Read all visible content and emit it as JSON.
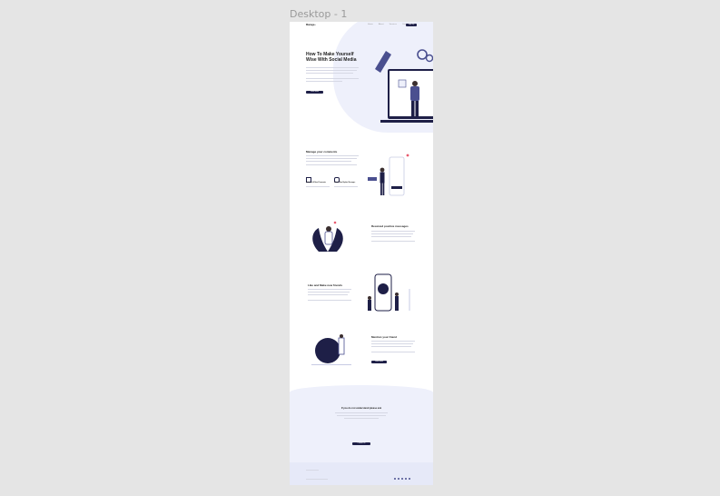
{
  "frame_title": "Desktop - 1",
  "nav": {
    "logo": "Manage+",
    "links": [
      "Home",
      "About",
      "Services",
      "Contact"
    ],
    "cta": "Sign Up"
  },
  "hero": {
    "title_line1": "How To Make Yourself",
    "title_line2": "Wise With Social Media",
    "button": "Learn More"
  },
  "section1": {
    "title": "Manage your comments",
    "feature1": "Reviewed & Read Comments",
    "feature2": "Recent New Replies Messages"
  },
  "section2": {
    "title": "Received positive messages"
  },
  "section3": {
    "title": "Like and Make new friends"
  },
  "section4": {
    "title": "Mention your friend",
    "button": "Learn More"
  },
  "cta_section": {
    "title": "If you do not understand please ask",
    "button": "Contact Us"
  },
  "colors": {
    "background": "#e5e5e5",
    "accent": "#1e1f47",
    "light": "#eef0fb"
  }
}
